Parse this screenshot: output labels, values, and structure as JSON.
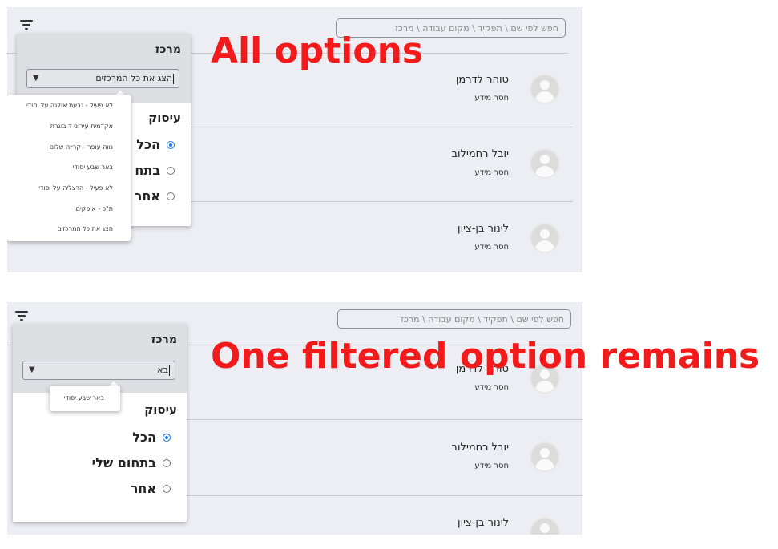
{
  "annotations": {
    "top": "All options",
    "bottom": "One filtered option remains"
  },
  "search": {
    "placeholder": "חפש לפי שם \\ תפקיד \\ מקום עבודה \\ מרכז"
  },
  "people": [
    {
      "name": "טוהר לדרמן",
      "status": "חסר מידע"
    },
    {
      "name": "יובל רחמילוב",
      "status": "חסר מידע"
    },
    {
      "name": "לינור בן-ציון",
      "status": "חסר מידע"
    }
  ],
  "filter": {
    "center_title": "מרכז",
    "employment_title": "עיסוק",
    "options": [
      "הכל",
      "בתחום שלי",
      "אחר"
    ],
    "top_select_value": "הצג את כל המרכזים",
    "bottom_select_value": "בא",
    "top_partial_options": [
      "הכל",
      "בתח",
      "אחר"
    ]
  },
  "dropdown_all": [
    "לא פעיל - גבעת אולגה על יסודי",
    "אקדמית עירוני ד בוגרת",
    "נווה עופר - קריית שלום",
    "באר שבע יסודי",
    "לא פעיל - הרצליה על יסודי",
    "ת\"כ - אופקים",
    "הצג את כל המרכזים"
  ],
  "dropdown_filtered": [
    "באר שבע יסודי"
  ],
  "icons": {
    "filter": "filter-icon",
    "avatar": "avatar-icon",
    "caret": "chevron-down-icon"
  },
  "colors": {
    "annotation": "#f21a1a",
    "panel_bg": "#eceef3",
    "radio_selected": "#1e73e8"
  }
}
